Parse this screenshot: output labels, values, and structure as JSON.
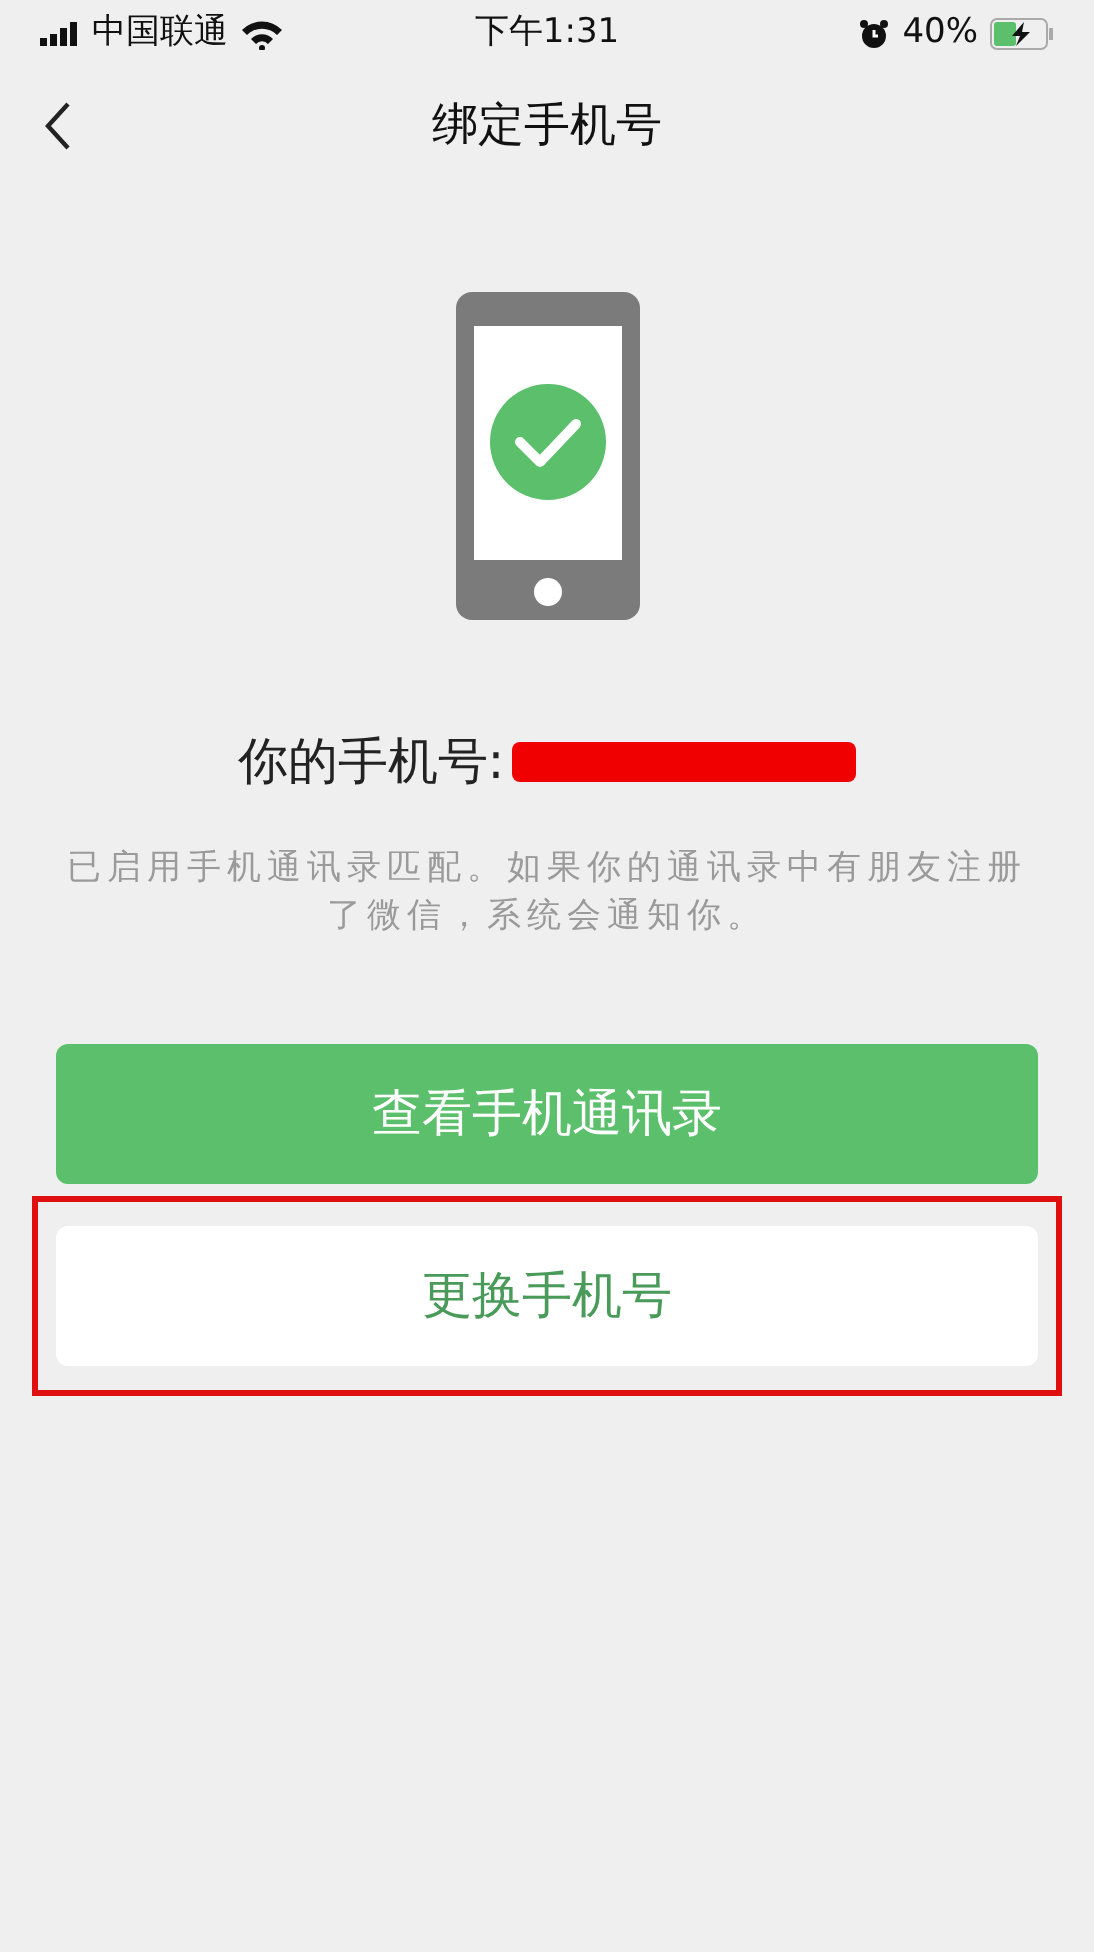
{
  "status_bar": {
    "carrier": "中国联通",
    "time": "下午1:31",
    "battery": "40%"
  },
  "nav": {
    "title": "绑定手机号"
  },
  "phone": {
    "label": "你的手机号:",
    "redacted": true
  },
  "description": "已启用手机通讯录匹配。如果你的通讯录中有朋友注册了微信，系统会通知你。",
  "buttons": [
    {
      "label": "查看手机通讯录",
      "kind": "primary",
      "highlighted": false
    },
    {
      "label": "更换手机号",
      "kind": "secondary",
      "highlighted": true
    }
  ]
}
